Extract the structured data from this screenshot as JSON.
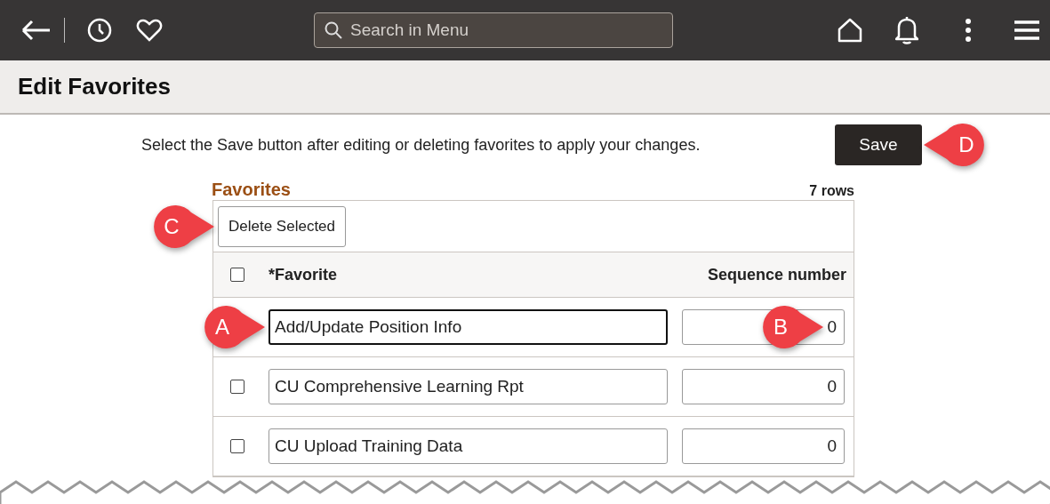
{
  "search": {
    "placeholder": "Search in Menu"
  },
  "page_title": "Edit Favorites",
  "instruction": "Select the Save button after editing or deleting favorites to apply your changes.",
  "save_button": {
    "label": "Save",
    "callout": "D"
  },
  "grid": {
    "title": "Favorites",
    "row_count": "7 rows",
    "delete_button": {
      "label": "Delete Selected",
      "callout": "C"
    },
    "select_all_checked": false,
    "columns": [
      "*Favorite",
      "Sequence number"
    ],
    "rows": [
      {
        "favorite": "Add/Update Position Info",
        "sequence": "0",
        "focused": true,
        "favorite_callout": "A",
        "sequence_callout": "B"
      },
      {
        "checked": false,
        "favorite": "CU Comprehensive Learning Rpt",
        "sequence": "0",
        "focused": false
      },
      {
        "checked": false,
        "favorite": "CU Upload Training Data",
        "sequence": "0",
        "focused": false
      }
    ]
  }
}
